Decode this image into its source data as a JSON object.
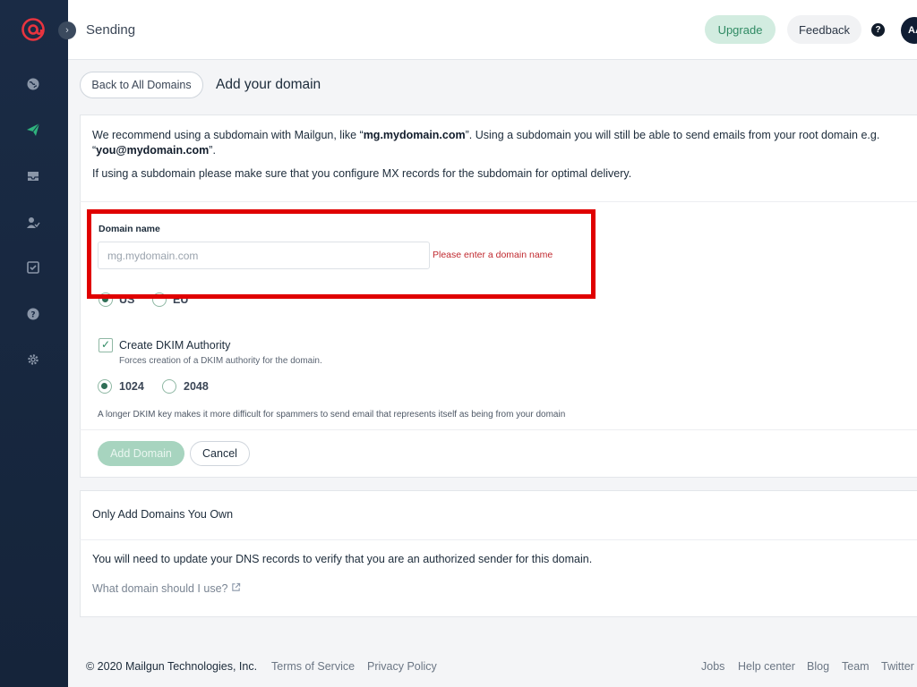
{
  "sidebar": {
    "logo": "mailgun-logo-icon",
    "items": [
      {
        "icon": "globe-icon"
      },
      {
        "icon": "paper-plane-icon",
        "active": true
      },
      {
        "icon": "inbox-icon"
      },
      {
        "icon": "user-check-icon"
      },
      {
        "icon": "checkbox-icon"
      },
      {
        "icon": "question-circle-icon"
      },
      {
        "icon": "gear-icon"
      }
    ],
    "collapse_glyph": "›"
  },
  "topbar": {
    "title": "Sending",
    "upgrade_label": "Upgrade",
    "feedback_label": "Feedback",
    "help_glyph": "?",
    "avatar_initials": "AA"
  },
  "header": {
    "back_label": "Back to All Domains",
    "page_title": "Add your domain"
  },
  "form": {
    "intro": {
      "t1": "We recommend using a subdomain with Mailgun, like “",
      "b1": "mg.mydomain.com",
      "t2": "”. Using a subdomain you will still be able to send emails from your root domain e.g. “",
      "b2": "you@mydomain.com",
      "t3": "”."
    },
    "intro2": "If using a subdomain please make sure that you configure MX records for the subdomain for optimal delivery.",
    "domain_label": "Domain name",
    "domain_value": "",
    "domain_placeholder": "mg.mydomain.com",
    "domain_error": "Please enter a domain name",
    "region_options": [
      {
        "label": "US",
        "checked": true
      },
      {
        "label": "EU",
        "checked": false
      }
    ],
    "dkim_checked": true,
    "dkim_label": "Create DKIM Authority",
    "dkim_help": "Forces creation of a DKIM authority for the domain.",
    "key_options": [
      {
        "label": "1024",
        "checked": true
      },
      {
        "label": "2048",
        "checked": false
      }
    ],
    "dkim_note": "A longer DKIM key makes it more difficult for spammers to send email that represents itself as being from your domain",
    "add_label": "Add Domain",
    "cancel_label": "Cancel"
  },
  "info_card": {
    "title": "Only Add Domains You Own",
    "text": "You will need to update your DNS records to verify that you are an authorized sender for this domain.",
    "link": "What domain should I use?"
  },
  "footer": {
    "copyright": "© 2020 Mailgun Technologies, Inc.",
    "left_links": [
      "Terms of Service",
      "Privacy Policy"
    ],
    "right_links": [
      "Jobs",
      "Help center",
      "Blog",
      "Team",
      "Twitter"
    ]
  },
  "colors": {
    "sidebar": "#1a2b45",
    "accent_green": "#2f8a63",
    "brand_red": "#e8343f",
    "error_red": "#c0292f",
    "highlight": "#e00000"
  }
}
